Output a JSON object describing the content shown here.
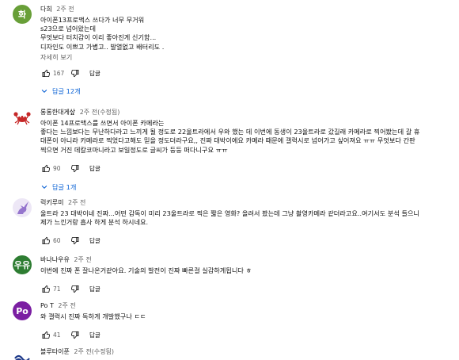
{
  "comments": [
    {
      "author": "다희",
      "time": "2주 전",
      "avatar_letter": "화",
      "avatar_color": "#689f38",
      "lines": [
        "아이폰13프로맥스 쓰다가 너무 무거워",
        "s23으로 넘어왔는데",
        "무엇보다 터치감이 이리 좋아진게 신기함...",
        "디자인도 이쁘고 가볍고.. 발열없고 배터리도 ."
      ],
      "read_more": "자세히 보기",
      "likes": "167",
      "reply_label": "답글",
      "replies_label": "답글 12개"
    },
    {
      "author": "롱롱한대게샆",
      "time": "2주 전(수정됨)",
      "avatar_icon": "crab-icon",
      "lines": [
        "아이폰 14프로맥스를 쓰면서 아이폰 카메라는",
        "좋다는 느낌보다는 무난하다라고 느끼게 될 정도로 22울트라에서 우와 했는 데 이번에 동생이 23울트라로 갔길래 카메라로 찍어봤는데 갈 휴",
        "대폰이 아니라 카메라로 찍었다고해도 믿을 정도더라구요,, 진짜 대박이에요 카메라 때문에 갤럭시로 넘어가고 싶어져요 ㅠㅠ 무엇보다 간판",
        "찍으면 거진 데칼코마니라고 보일정도로 글씨가 둥둥 떠다니구요 ㅠㅠ"
      ],
      "likes": "90",
      "reply_label": "답글",
      "replies_label": "답글 1개"
    },
    {
      "author": "럭키루미",
      "time": "2주 전",
      "avatar_icon": "unicorn-icon",
      "lines": [
        "울트라 23 대박이네 진짜...어떤 감독이 미리 23울트라로 찍은 짧은  영화? 올려서 봤는데 그냥 촬영카메라 같더라고요..여기서도 분석 들으니",
        "제가 느낀거랑 흡사 하게 분석 하시네요."
      ],
      "likes": "60",
      "reply_label": "답글"
    },
    {
      "author": "바나나우유",
      "time": "2주 전",
      "avatar_letter": "우유",
      "avatar_color": "#2e7d32",
      "lines": [
        "이번에 진짜 폰 잘나온거같아요. 기술의 발전이 진짜 빠른걸 실감하게됩니다 ㅎ"
      ],
      "likes": "71",
      "reply_label": "답글"
    },
    {
      "author": "Po T",
      "time": "2주 전",
      "avatar_letter": "Po",
      "avatar_color": "#7b1fa2",
      "lines": [
        "와 갤럭시 진짜 독하게 개발했구나 ㄷㄷ"
      ],
      "likes": "41",
      "reply_label": "답글"
    },
    {
      "author": "블루타이푼",
      "time": "2주 전(수정됨)",
      "avatar_icon": "wave-icon"
    }
  ]
}
